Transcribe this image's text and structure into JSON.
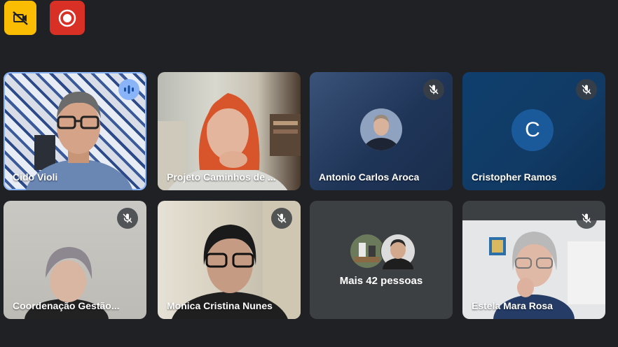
{
  "toolbar": {
    "left_button_icon": "no-video-icon",
    "record_button_icon": "record-icon"
  },
  "participants": [
    {
      "name": "Cido Violi",
      "speaking": true
    },
    {
      "name": "Projeto Caminhos de ...",
      "muted": false
    },
    {
      "name": "Antonio Carlos Aroca",
      "muted": true
    },
    {
      "name": "Cristopher Ramos",
      "muted": true,
      "initial": "C"
    },
    {
      "name": "Coordenação Gestão...",
      "muted": true
    },
    {
      "name": "Monica Cristina Nunes",
      "muted": true
    },
    {
      "name": "Estela Mara Rosa",
      "muted": true
    }
  ],
  "more": {
    "label": "Mais 42 pessoas"
  },
  "colors": {
    "background": "#202124",
    "tile": "#3c4043",
    "accent_yellow": "#fbbc04",
    "accent_red": "#d93025",
    "speaking_blue": "#8ab4f8"
  }
}
